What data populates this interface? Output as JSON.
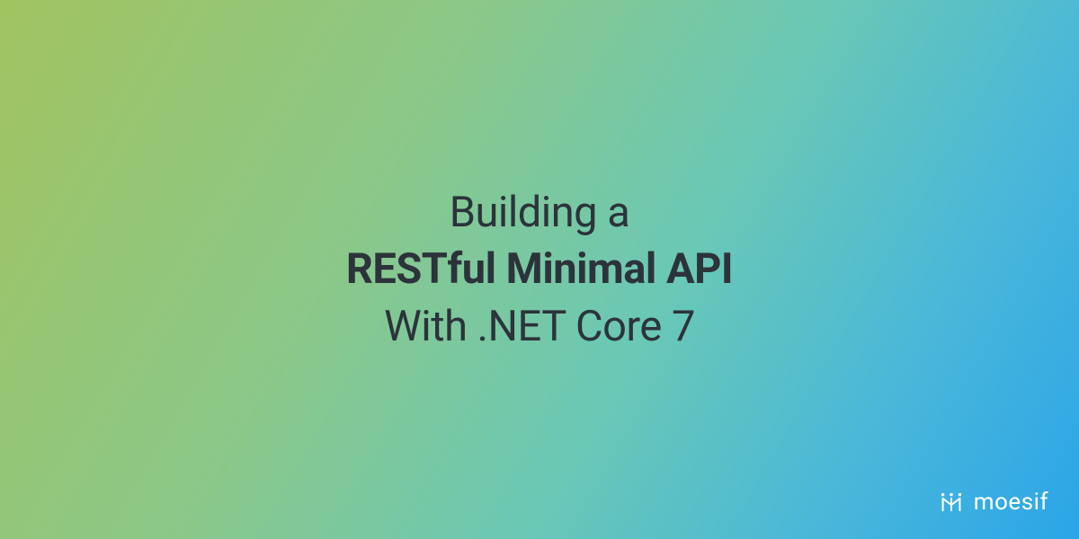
{
  "hero": {
    "line1": "Building a",
    "line2": "RESTful Minimal API",
    "line3": "With .NET Core 7"
  },
  "brand": {
    "name": "moesif",
    "icon": "moesif-logo"
  }
}
